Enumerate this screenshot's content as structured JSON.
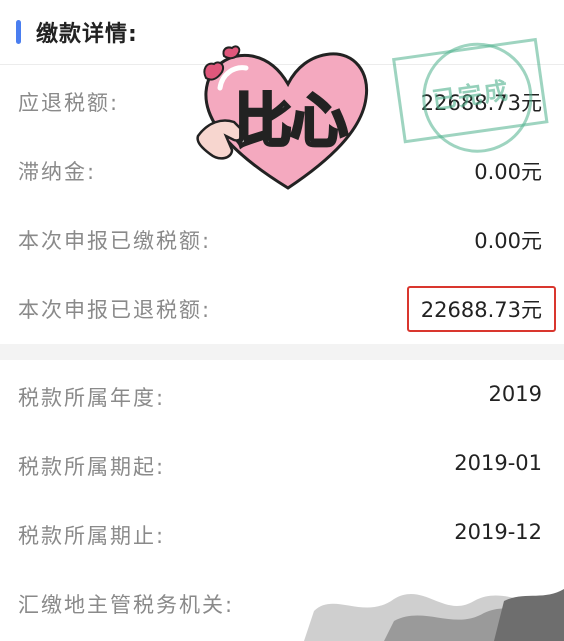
{
  "colors": {
    "accent": "#4a7ef0",
    "highlight_border": "#d9362e",
    "stamp": "#4eb08c",
    "heart_pink": "#f4a9bf"
  },
  "header": {
    "title": "缴款详情:"
  },
  "details": [
    {
      "label": "应退税额:",
      "value": "22688.73元"
    },
    {
      "label": "滞纳金:",
      "value": "0.00元"
    },
    {
      "label": "本次申报已缴税额:",
      "value": "0.00元"
    },
    {
      "label": "本次申报已退税额:",
      "value": "22688.73元"
    }
  ],
  "period": [
    {
      "label": "税款所属年度:",
      "value": "2019"
    },
    {
      "label": "税款所属期起:",
      "value": "2019-01"
    },
    {
      "label": "税款所属期止:",
      "value": "2019-12"
    },
    {
      "label": "汇缴地主管税务机关:",
      "value": ""
    }
  ],
  "sticker": {
    "text": "比心",
    "icon": "heart-hand-icon"
  },
  "stamp": {
    "text": "已完成"
  }
}
